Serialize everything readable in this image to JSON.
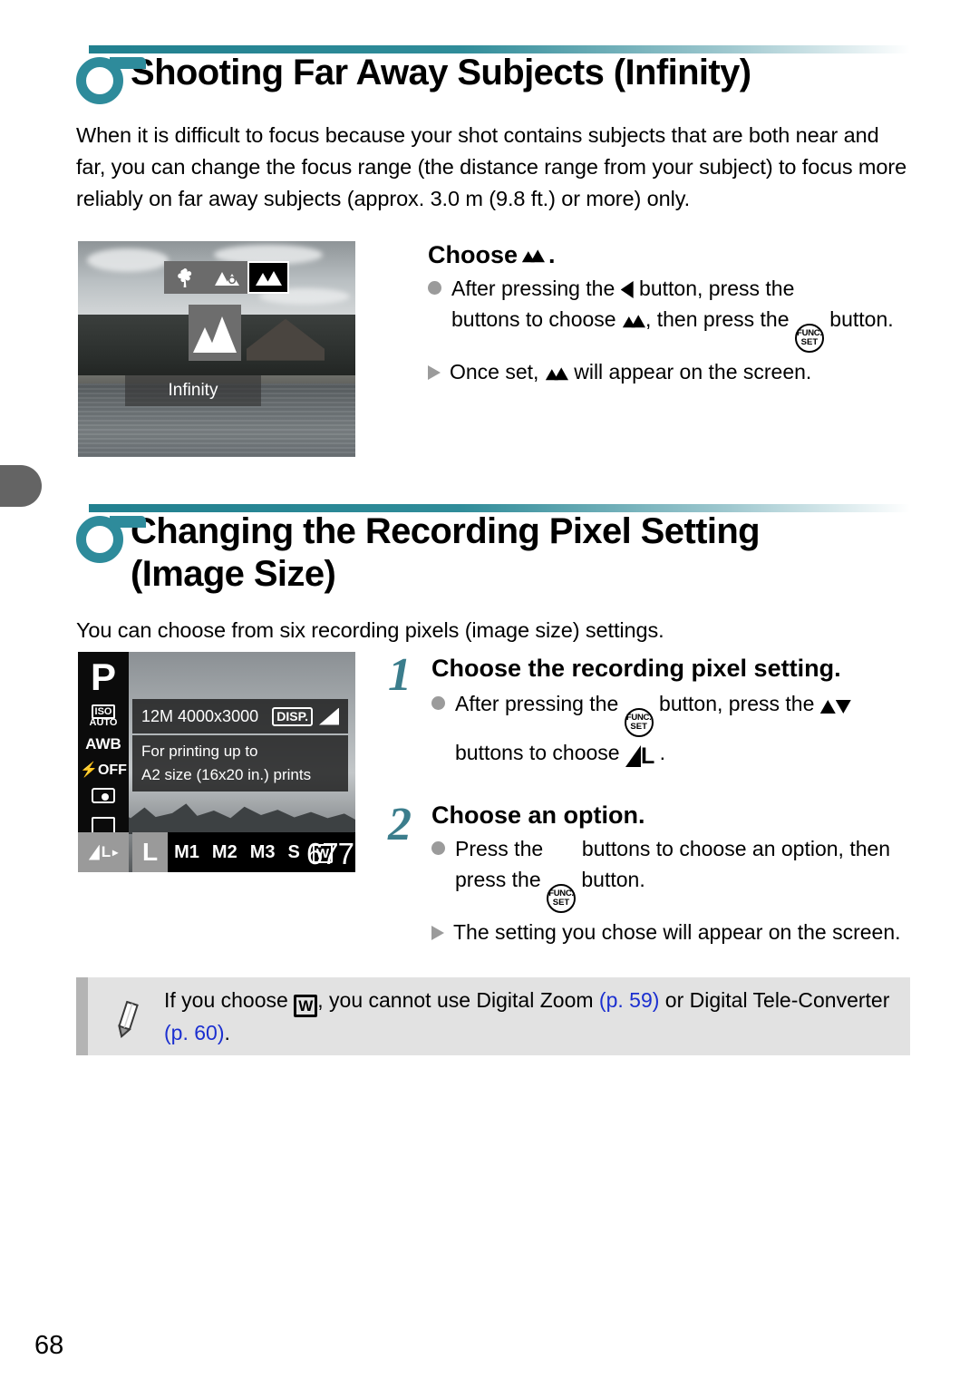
{
  "page": {
    "folio": "68"
  },
  "sections": [
    {
      "id": "infinity",
      "title": "Shooting Far Away Subjects (Infinity)",
      "intro": "When it is difficult to focus because your shot contains subjects that are both near and far, you can change the focus range (the distance range from your subject) to focus more reliably on far away subjects (approx. 3.0 m (9.8 ft.) or more) only.",
      "screenshot": {
        "name": "focus-range-screen",
        "mode_label": "Infinity",
        "modes": [
          "macro",
          "auto-macro",
          "infinity"
        ],
        "selected_mode": "infinity"
      },
      "instruction": {
        "heading_prefix": "Choose",
        "heading_suffix": ".",
        "heading_icon": "mountain-icon",
        "bullets": [
          {
            "marker": "dot",
            "parts": [
              {
                "t": "After pressing the "
              },
              {
                "icon": "left-button-icon"
              },
              {
                "t": " button, press the "
              },
              {
                "icon": "left-right-buttons-icon"
              },
              {
                "t": " buttons to choose "
              },
              {
                "icon": "mountain-icon"
              },
              {
                "t": ", then press the "
              },
              {
                "icon": "func-set-button-icon"
              },
              {
                "t": " button."
              }
            ]
          },
          {
            "marker": "triangle",
            "parts": [
              {
                "t": "Once set, "
              },
              {
                "icon": "mountain-icon"
              },
              {
                "t": " will appear on the screen."
              }
            ]
          }
        ]
      }
    },
    {
      "id": "recording-pixels",
      "title": "Changing the Recording Pixel Setting\n(Image Size)",
      "intro": "You can choose from six recording pixels (image size) settings.",
      "screenshot": {
        "name": "func-menu-screen",
        "mode": "P",
        "left_items": [
          "ISO AUTO",
          "AWB",
          "OFF",
          "metering",
          "drive"
        ],
        "info_line": "12M 4000x3000",
        "disp_label": "DISP.",
        "description_lines": [
          "For printing up to",
          "A2 size (16x20 in.) prints"
        ],
        "selected_left": "L",
        "options": [
          "L",
          "M1",
          "M2",
          "M3",
          "S",
          "W"
        ],
        "selected_option": "L",
        "shots_remaining": "677"
      },
      "steps": [
        {
          "num": "1",
          "title": "Choose the recording pixel setting.",
          "bullets": [
            {
              "marker": "dot",
              "parts": [
                {
                  "t": "After pressing the "
                },
                {
                  "icon": "func-set-button-icon"
                },
                {
                  "t": " button, press the "
                },
                {
                  "icon": "up-down-buttons-icon"
                },
                {
                  "t": " buttons to choose "
                },
                {
                  "icon": "large-size-icon"
                },
                {
                  "t": " ."
                }
              ]
            }
          ]
        },
        {
          "num": "2",
          "title": "Choose an option.",
          "bullets": [
            {
              "marker": "dot",
              "parts": [
                {
                  "t": "Press the "
                },
                {
                  "icon": "left-right-buttons-icon"
                },
                {
                  "t": " buttons to choose an option, then press the "
                },
                {
                  "icon": "func-set-button-icon"
                },
                {
                  "t": " button."
                }
              ]
            },
            {
              "marker": "triangle",
              "parts": [
                {
                  "t": "The setting you chose will appear on the screen."
                }
              ]
            }
          ]
        }
      ]
    }
  ],
  "note": {
    "icon": "pencil-icon",
    "parts": [
      {
        "t": "If you choose "
      },
      {
        "icon": "w-size-icon"
      },
      {
        "t": ", you cannot use Digital Zoom "
      },
      {
        "ref": "(p. 59)"
      },
      {
        "t": " or Digital Tele-Converter "
      },
      {
        "ref": "(p. 60)"
      },
      {
        "t": "."
      }
    ]
  },
  "colors": {
    "accent_teal": "#2e8b9b",
    "step_teal": "#3b7d8c",
    "link_blue": "#1b2fd0",
    "note_bg": "#e2e2e2",
    "tab_gray": "#646464"
  }
}
